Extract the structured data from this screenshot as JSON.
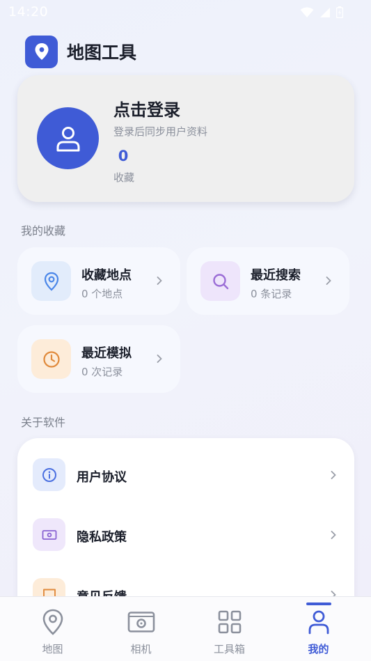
{
  "status_bar": {
    "time": "14:20",
    "icons": [
      "wifi-icon",
      "signal-icon",
      "battery-icon"
    ]
  },
  "app": {
    "title": "地图工具",
    "logo_icon": "map-pin-icon",
    "accent_color": "#3f5bd6"
  },
  "login": {
    "title": "点击登录",
    "subtitle": "登录后同步用户资料",
    "favorites_count": "0",
    "favorites_label": "收藏",
    "avatar_icon": "user-icon"
  },
  "favorites_section": {
    "title": "我的收藏",
    "cards": [
      {
        "title": "收藏地点",
        "subtitle": "0 个地点",
        "icon": "location-pin-icon",
        "icon_color": "#4a86e8",
        "icon_bg": "#e2ecfb"
      },
      {
        "title": "最近搜索",
        "subtitle": "0 条记录",
        "icon": "search-icon",
        "icon_color": "#9b6dd6",
        "icon_bg": "#eee5fb"
      },
      {
        "title": "最近模拟",
        "subtitle": "0 次记录",
        "icon": "clock-icon",
        "icon_color": "#e08a3c",
        "icon_bg": "#fdecd9"
      }
    ]
  },
  "about_section": {
    "title": "关于软件",
    "items": [
      {
        "label": "用户协议",
        "icon": "info-icon",
        "icon_color": "#4a6fe0",
        "icon_bg": "#e4ebfc"
      },
      {
        "label": "隐私政策",
        "icon": "privacy-icon",
        "icon_color": "#8a63d2",
        "icon_bg": "#efe7fb"
      },
      {
        "label": "意见反馈",
        "icon": "feedback-icon",
        "icon_color": "#e08a3c",
        "icon_bg": "#fdecd9"
      }
    ]
  },
  "tabbar": {
    "tabs": [
      {
        "label": "地图",
        "icon": "map-pin-icon",
        "active": false
      },
      {
        "label": "相机",
        "icon": "camera-icon",
        "active": false
      },
      {
        "label": "工具箱",
        "icon": "grid-icon",
        "active": false
      },
      {
        "label": "我的",
        "icon": "user-icon",
        "active": true
      }
    ]
  }
}
